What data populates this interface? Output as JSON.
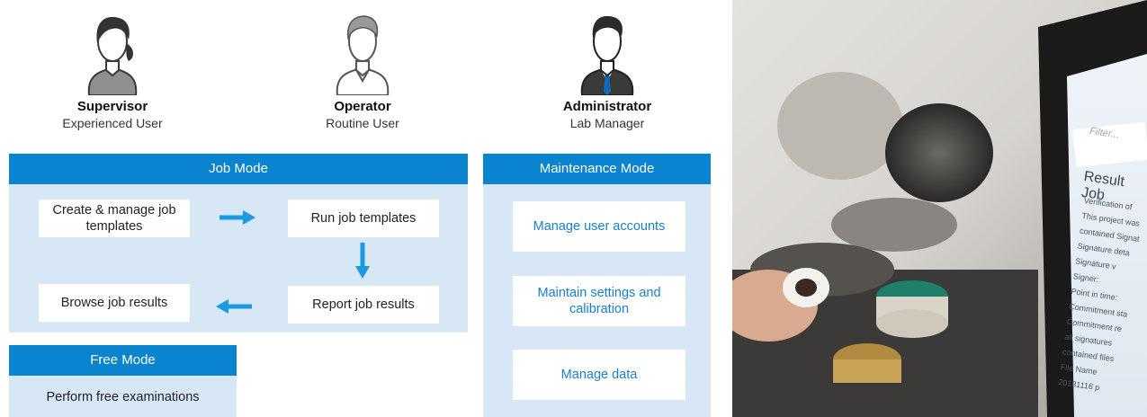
{
  "roles": [
    {
      "name": "Supervisor",
      "subtitle": "Experienced User"
    },
    {
      "name": "Operator",
      "subtitle": "Routine User"
    },
    {
      "name": "Administrator",
      "subtitle": "Lab Manager"
    }
  ],
  "job_mode": {
    "title": "Job Mode",
    "create_templates": "Create & manage job templates",
    "run_templates": "Run job templates",
    "report_results": "Report job results",
    "browse_results": "Browse job results"
  },
  "maintenance_mode": {
    "title": "Maintenance Mode",
    "items": [
      "Manage user accounts",
      "Maintain settings and calibration",
      "Manage data"
    ]
  },
  "free_mode": {
    "title": "Free Mode",
    "item": "Perform free examinations"
  },
  "screen": {
    "filter_placeholder": "Filter...",
    "heading": "Result Job",
    "lines": [
      "Verification of",
      "This project was",
      "contained Signat",
      "Signature deta",
      "Signature v",
      "Signer:",
      "Point in time:",
      "Commitment sta",
      "Commitment re",
      "all signatures",
      "contained files",
      "File Name",
      "20181116 p"
    ]
  },
  "colors": {
    "header_blue": "#0a84cf",
    "panel_bg": "#d7e7f6",
    "arrow_blue": "#1b9ae0",
    "link_blue": "#1a7fc9"
  }
}
